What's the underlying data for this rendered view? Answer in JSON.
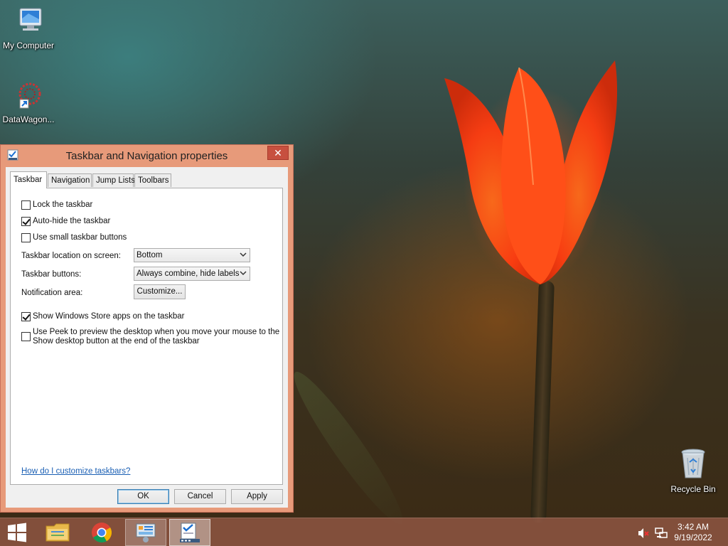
{
  "desktop": {
    "icons": [
      {
        "label": "My Computer",
        "icon": "computer-icon"
      },
      {
        "label": "DataWagon...",
        "icon": "datawagon-shortcut-icon"
      },
      {
        "label": "Recycle Bin",
        "icon": "recycle-bin-icon"
      }
    ]
  },
  "dialog": {
    "title": "Taskbar and Navigation properties",
    "close_label": "✕",
    "tabs": [
      {
        "label": "Taskbar",
        "active": true
      },
      {
        "label": "Navigation",
        "active": false
      },
      {
        "label": "Jump Lists",
        "active": false
      },
      {
        "label": "Toolbars",
        "active": false
      }
    ],
    "options": {
      "lock_taskbar": {
        "label": "Lock the taskbar",
        "checked": false
      },
      "auto_hide": {
        "label": "Auto-hide the taskbar",
        "checked": true
      },
      "small_buttons": {
        "label": "Use small taskbar buttons",
        "checked": false
      },
      "store_apps": {
        "label": "Show Windows Store apps on the taskbar",
        "checked": true
      },
      "peek_line1": "Use Peek to preview the desktop when you move your mouse to the",
      "peek_line2": "Show desktop button at the end of the taskbar",
      "peek_checked": false
    },
    "location": {
      "label": "Taskbar location on screen:",
      "value": "Bottom"
    },
    "buttons_setting": {
      "label": "Taskbar buttons:",
      "value": "Always combine, hide labels"
    },
    "notification": {
      "label": "Notification area:",
      "button": "Customize..."
    },
    "help_link": "How do I customize taskbars?",
    "footer": {
      "ok": "OK",
      "cancel": "Cancel",
      "apply": "Apply"
    }
  },
  "taskbar": {
    "items": [
      "start-button",
      "file-explorer",
      "chrome",
      "control-panel",
      "taskbar-properties"
    ],
    "clock": {
      "time": "3:42 AM",
      "date": "9/19/2022"
    },
    "tray": [
      "volume-muted-icon",
      "network-icon"
    ]
  },
  "colors": {
    "accent": "#e79a7a",
    "taskbar": "#965a46",
    "close": "#c7503f",
    "link": "#1a5fb4"
  }
}
